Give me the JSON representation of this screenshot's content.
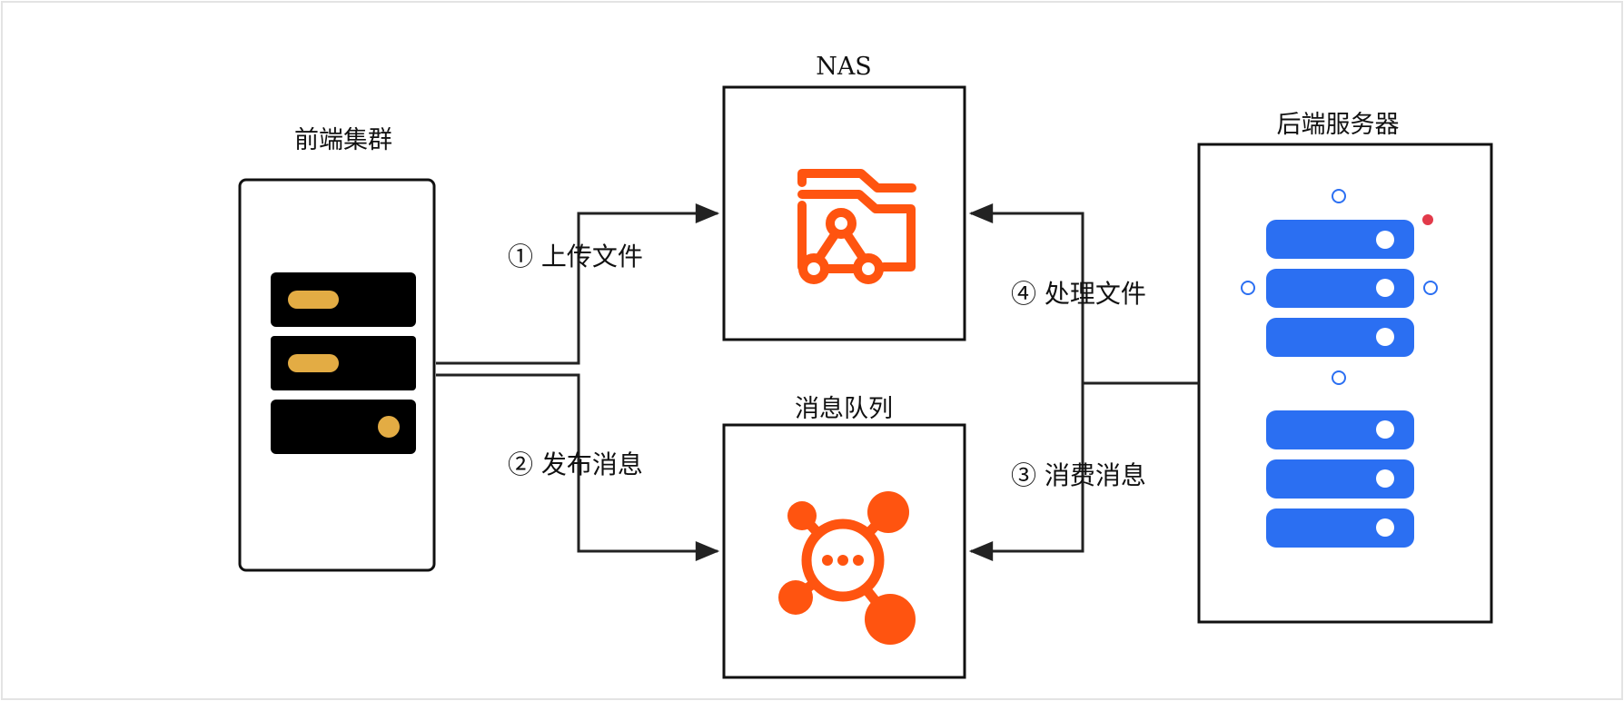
{
  "nodes": {
    "frontend": {
      "title": "前端集群",
      "icon": "server-rack-icon"
    },
    "nas": {
      "title": "NAS",
      "icon": "shared-folder-icon"
    },
    "queue": {
      "title": "消息队列",
      "icon": "message-hub-icon"
    },
    "backend": {
      "title": "后端服务器",
      "icon": "server-stack-icon"
    }
  },
  "edges": {
    "upload": "① 上传文件",
    "publish": "② 发布消息",
    "consume": "③ 消费消息",
    "process": "④ 处理文件"
  },
  "colors": {
    "line": "#222222",
    "frontend_rack": "#000000",
    "frontend_accent": "#e3ac44",
    "icon_orange": "#ff5410",
    "backend_blue": "#2b6ff2",
    "selection_handle": "#2b6ff2",
    "status_dot": "#e23a4a"
  }
}
